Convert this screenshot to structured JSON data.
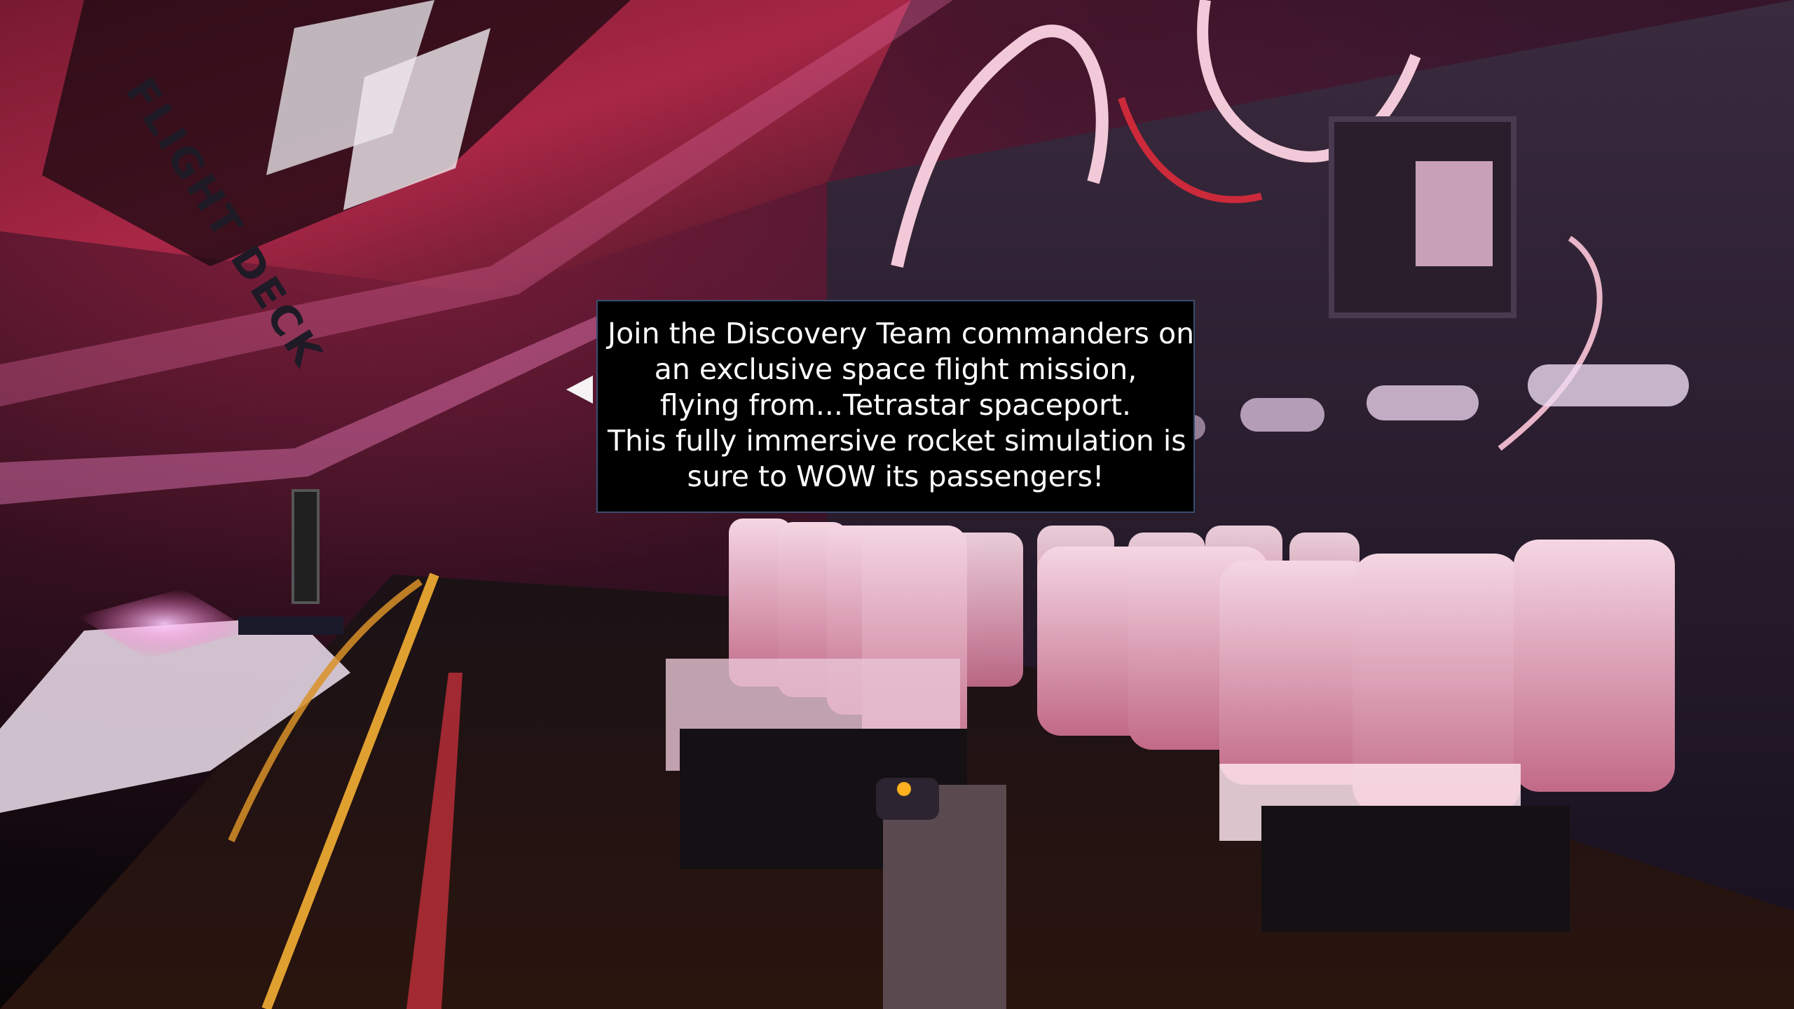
{
  "scene": {
    "wall_sign": "FLIGHT DECK"
  },
  "info_panel": {
    "lines": [
      "Join the Discovery Team commanders on",
      "an exclusive space flight mission,",
      "flying from...Tetrastar spaceport.",
      "This fully immersive rocket simulation is",
      "sure to WOW its passengers!"
    ]
  },
  "colors": {
    "panel_background": "#000000",
    "panel_border": "#3a4d70",
    "panel_text": "#ffffff",
    "ambient_red": "#d8284c",
    "ambient_purple": "#8a4f9e"
  },
  "icons": {
    "hotspot": "left-arrow-icon"
  }
}
